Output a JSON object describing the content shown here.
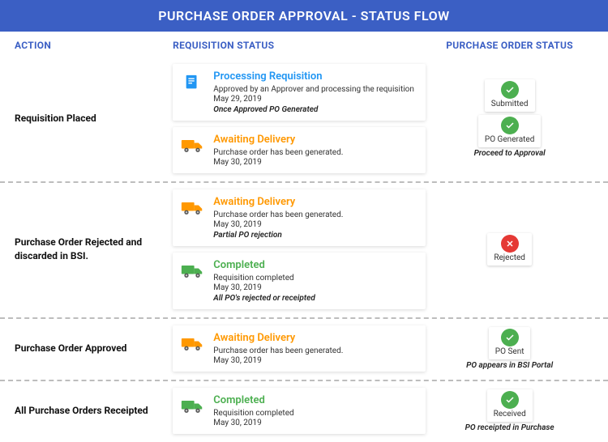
{
  "title": "PURCHASE ORDER APPROVAL - STATUS FLOW",
  "columns": {
    "action": "ACTION",
    "requisition": "REQUISITION STATUS",
    "po": "PURCHASE ORDER STATUS"
  },
  "rows": [
    {
      "action": "Requisition Placed",
      "reqs": [
        {
          "icon": "doc-blue",
          "title": "Processing Requisition",
          "titleColor": "blue",
          "sub": "Approved by an Approver and processing the requisition",
          "date": "May 29, 2019",
          "note": "Once Approved PO Generated"
        },
        {
          "icon": "truck-orange",
          "title": "Awaiting Delivery",
          "titleColor": "orange",
          "sub": "Purchase order has been generated.",
          "date": "May 30, 2019",
          "note": ""
        }
      ],
      "po": [
        {
          "kind": "badge",
          "status": "ok",
          "label": "Submitted"
        },
        {
          "kind": "badge",
          "status": "ok",
          "label": "PO Generated",
          "note": "Proceed to Approval"
        }
      ]
    },
    {
      "action": "Purchase Order Rejected and discarded in BSI.",
      "reqs": [
        {
          "icon": "truck-orange",
          "title": "Awaiting Delivery",
          "titleColor": "orange",
          "sub": "Purchase order has been generated.",
          "date": "May 30, 2019",
          "note": "Partial PO rejection"
        },
        {
          "icon": "truck-green",
          "title": "Completed",
          "titleColor": "green",
          "sub": "Requisition completed",
          "date": "May 30, 2019",
          "note": "All PO's rejected or receipted"
        }
      ],
      "po": [
        {
          "kind": "badge",
          "status": "reject",
          "label": "Rejected"
        }
      ]
    },
    {
      "action": "Purchase Order Approved",
      "reqs": [
        {
          "icon": "truck-orange",
          "title": "Awaiting Delivery",
          "titleColor": "orange",
          "sub": "Purchase order has been generated.",
          "date": "May 30, 2019",
          "note": ""
        }
      ],
      "po": [
        {
          "kind": "badge",
          "status": "ok",
          "label": "PO Sent",
          "note": "PO appears in BSI Portal"
        }
      ]
    },
    {
      "action": "All Purchase Orders Receipted",
      "reqs": [
        {
          "icon": "truck-green",
          "title": "Completed",
          "titleColor": "green",
          "sub": "Requisition completed",
          "date": "May 30, 2019",
          "note": ""
        }
      ],
      "po": [
        {
          "kind": "badge",
          "status": "ok",
          "label": "Received",
          "note": "PO receipted in Purchase"
        }
      ]
    }
  ]
}
